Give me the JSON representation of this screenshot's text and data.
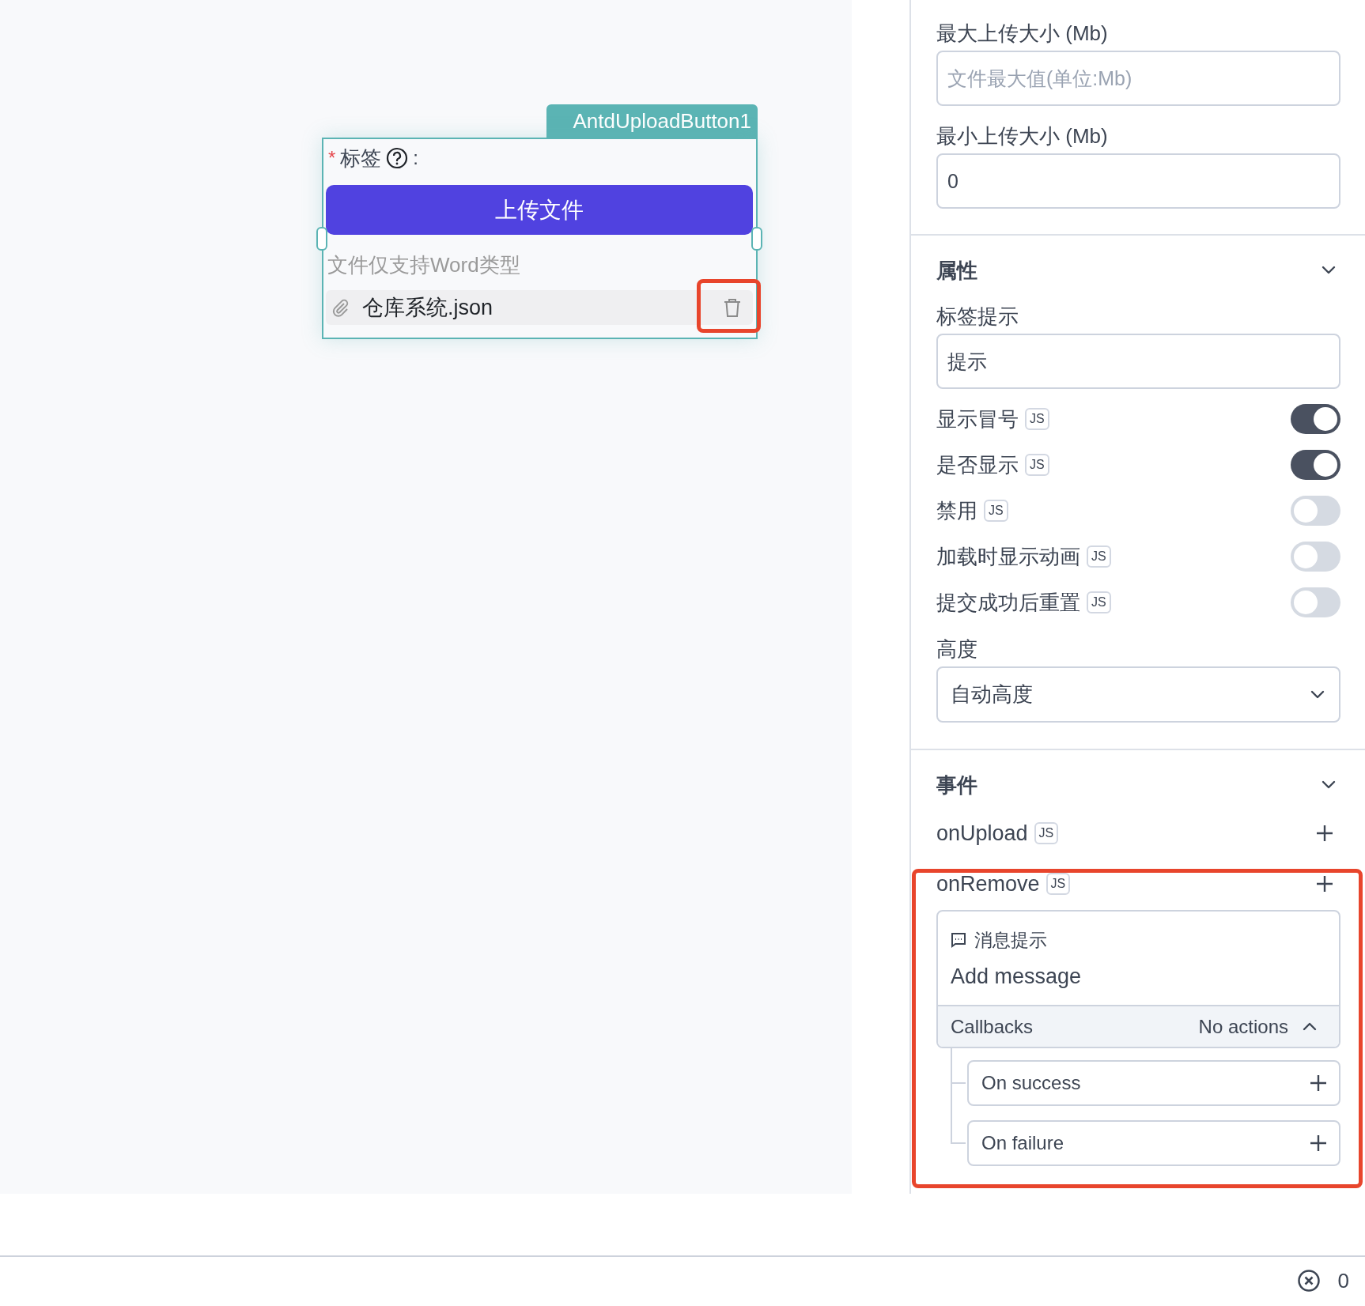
{
  "canvas": {
    "component": {
      "name_tag": "AntdUploadButton1",
      "required_mark": "*",
      "label": "标签",
      "label_suffix": ":",
      "button": "上传文件",
      "hint": "文件仅支持Word类型",
      "files": [
        {
          "name": "仓库系统.json"
        }
      ]
    }
  },
  "size_fields": [
    {
      "label": "最大上传大小 (Mb)",
      "placeholder": "文件最大值(单位:Mb)"
    },
    {
      "label": "最小上传大小 (Mb)",
      "value": "0"
    }
  ],
  "properties": {
    "title": "属性",
    "tooltip_field": {
      "label": "标签提示",
      "value": "提示"
    },
    "toggles": [
      {
        "label": "显示冒号",
        "badge": "JS",
        "on": true
      },
      {
        "label": "是否显示",
        "badge": "JS",
        "on": true
      },
      {
        "label": "禁用",
        "badge": "JS",
        "on": false
      },
      {
        "label": "加载时显示动画",
        "badge": "JS",
        "on": false
      },
      {
        "label": "提交成功后重置",
        "badge": "JS",
        "on": false
      }
    ],
    "height": {
      "label": "高度",
      "value": "自动高度"
    }
  },
  "events": {
    "title": "事件",
    "items": [
      {
        "name": "onUpload",
        "badge": "JS"
      },
      {
        "name": "onRemove",
        "badge": "JS",
        "action": {
          "type": "消息提示",
          "text": "Add message",
          "callbacks_label": "Callbacks",
          "callbacks_status": "No actions",
          "callbacks": [
            "On success",
            "On failure"
          ]
        }
      }
    ]
  },
  "status_bar": {
    "error_count": "0"
  }
}
